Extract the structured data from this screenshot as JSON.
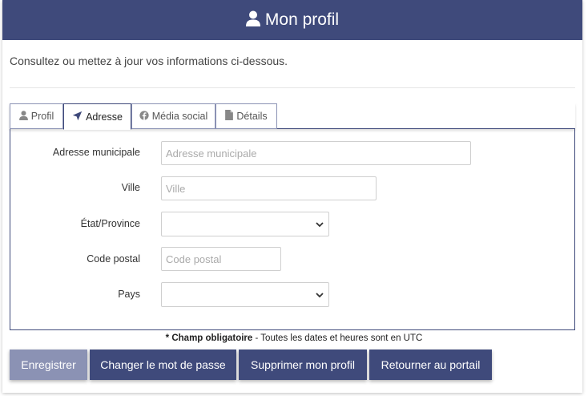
{
  "header": {
    "title": "Mon profil",
    "icon": "user-icon"
  },
  "intro": "Consultez ou mettez à jour vos informations ci-dessous.",
  "tabs": [
    {
      "label": "Profil",
      "icon": "user-icon",
      "active": false
    },
    {
      "label": "Adresse",
      "icon": "paper-plane-icon",
      "active": true
    },
    {
      "label": "Média social",
      "icon": "facebook-icon",
      "active": false
    },
    {
      "label": "Détails",
      "icon": "document-icon",
      "active": false
    }
  ],
  "form": {
    "street": {
      "label": "Adresse municipale",
      "placeholder": "Adresse municipale",
      "value": ""
    },
    "city": {
      "label": "Ville",
      "placeholder": "Ville",
      "value": ""
    },
    "state": {
      "label": "État/Province",
      "value": ""
    },
    "postal": {
      "label": "Code postal",
      "placeholder": "Code postal",
      "value": ""
    },
    "country": {
      "label": "Pays",
      "value": ""
    }
  },
  "note": {
    "required": "* Champ obligatoire",
    "rest": " - Toutes les dates et heures sont en UTC"
  },
  "buttons": {
    "save": "Enregistrer",
    "change_password": "Changer le mot de passe",
    "delete_profile": "Supprimer mon profil",
    "back_to_portal": "Retourner au portail"
  },
  "colors": {
    "primary": "#3f4a7b",
    "disabled": "#8b92b4"
  }
}
